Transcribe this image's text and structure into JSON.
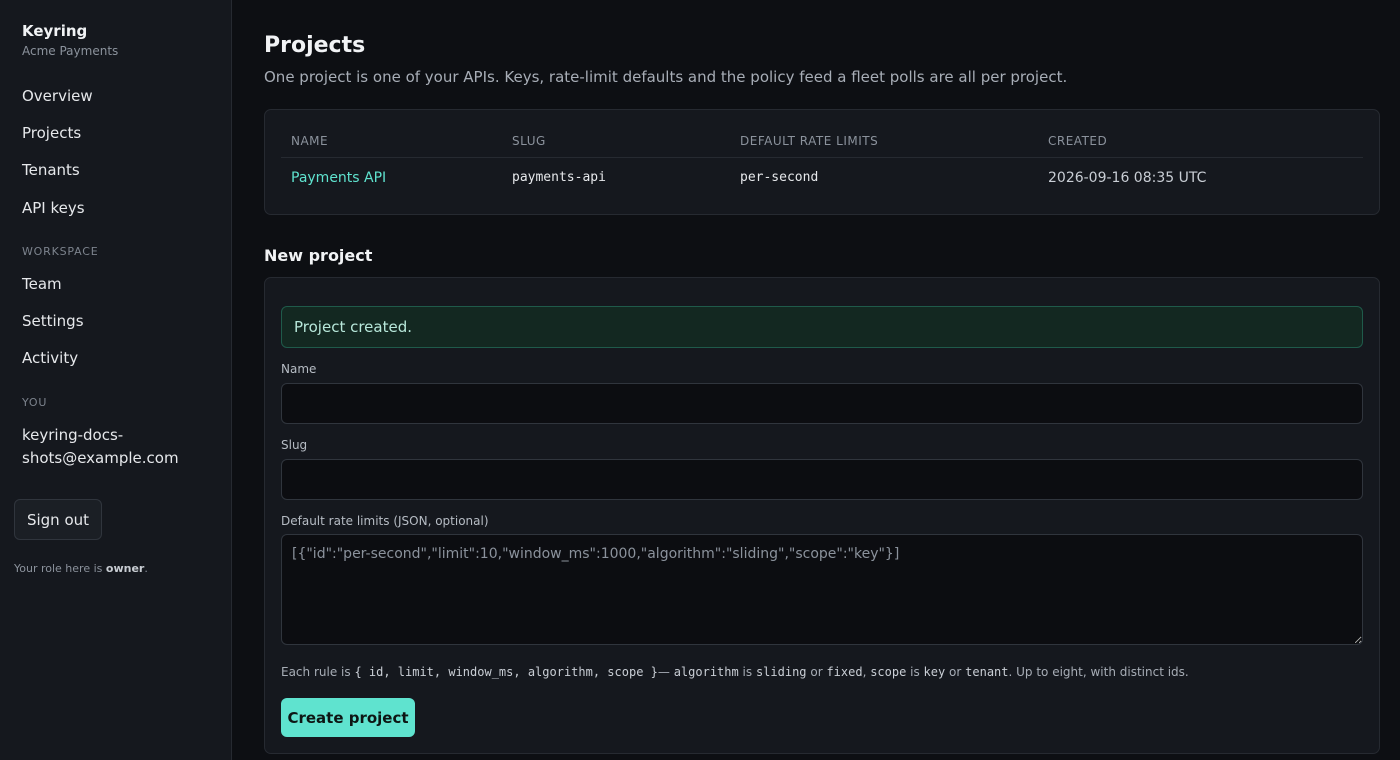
{
  "sidebar": {
    "brand": "Keyring",
    "org": "Acme Payments",
    "nav": [
      "Overview",
      "Projects",
      "Tenants",
      "API keys"
    ],
    "workspace_heading": "WORKSPACE",
    "workspace_items": [
      "Team",
      "Settings",
      "Activity"
    ],
    "you_heading": "YOU",
    "user_email": "keyring-docs-shots@example.com",
    "signout_label": "Sign out",
    "role_prefix": "Your role here is",
    "role": "owner",
    "role_suffix": "."
  },
  "page": {
    "title": "Projects",
    "description": "One project is one of your APIs. Keys, rate-limit defaults and the policy feed a fleet polls are all per project."
  },
  "table": {
    "headers": [
      "NAME",
      "SLUG",
      "DEFAULT RATE LIMITS",
      "CREATED"
    ],
    "rows": [
      {
        "name": "Payments API",
        "slug": "payments-api",
        "limits": "per-second",
        "created": "2026-09-16 08:35 UTC"
      }
    ]
  },
  "form": {
    "title": "New project",
    "alert": "Project created.",
    "name_label": "Name",
    "name_value": "",
    "slug_label": "Slug",
    "slug_value": "",
    "limits_label": "Default rate limits (JSON, optional)",
    "limits_placeholder": "[{\"id\":\"per-second\",\"limit\":10,\"window_ms\":1000,\"algorithm\":\"sliding\",\"scope\":\"key\"}]",
    "help": {
      "p1": "Each rule is ",
      "c1": "{ id, limit, window_ms, algorithm, scope }",
      "p2": "— ",
      "c2": "algorithm",
      "p3": " is ",
      "c3": "sliding",
      "p4": " or ",
      "c4": "fixed",
      "p5": ", ",
      "c5": "scope",
      "p6": " is ",
      "c6": "key",
      "p7": " or ",
      "c7": "tenant",
      "p8": ". Up to eight, with distinct ids."
    },
    "submit_label": "Create project"
  },
  "colors": {
    "accent": "#5fe3cf",
    "background": "#0d0f13",
    "sidebar": "#15181e"
  }
}
